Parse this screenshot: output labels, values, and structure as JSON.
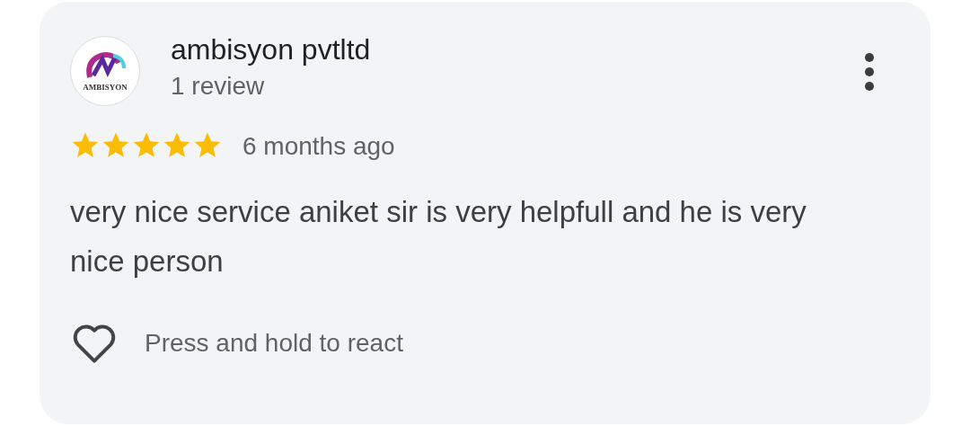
{
  "review": {
    "avatar_text": "AMBISYON",
    "author": "ambisyon pvtltd",
    "review_count": "1 review",
    "stars": 5,
    "time": "6 months ago",
    "text": "very nice service aniket sir is very helpfull and he is very nice person",
    "react_hint": "Press and hold to react"
  }
}
